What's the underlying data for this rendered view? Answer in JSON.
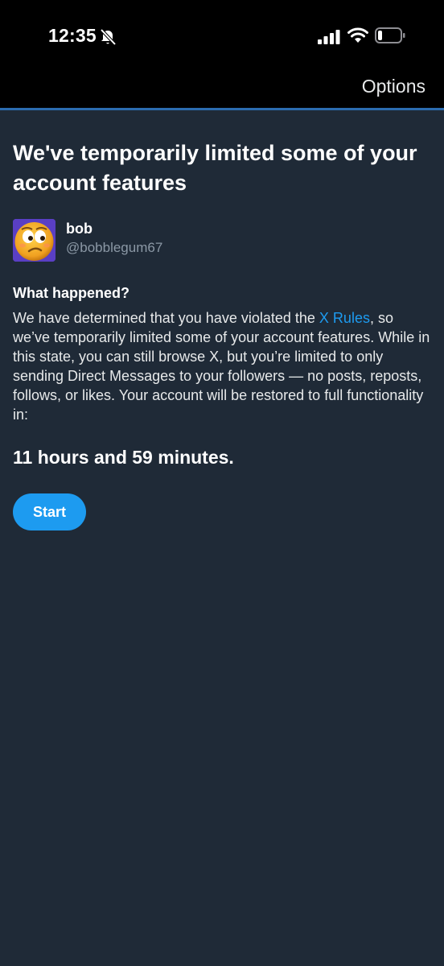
{
  "status_bar": {
    "time": "12:35",
    "icons": [
      "bell-muted-icon",
      "cellular-signal-icon",
      "wifi-icon",
      "battery-icon"
    ]
  },
  "navbar": {
    "options_label": "Options"
  },
  "notice": {
    "title": "We've temporarily limited some of your account features",
    "user": {
      "display_name": "bob",
      "handle": "@bobblegum67"
    },
    "section_heading": "What happened?",
    "body_before_link": "We have determined that you have violated the ",
    "link_text": "X Rules",
    "body_after_link": ", so we’ve temporarily limited some of your account features. While in this state, you can still browse X, but you’re limited to only sending Direct Messages to your followers — no posts, reposts, follows, or likes. Your account will be restored to full functionality in:",
    "countdown": "11 hours and 59 minutes.",
    "start_label": "Start"
  },
  "colors": {
    "background": "#1f2a37",
    "accent": "#1d9bf0",
    "header": "#000000",
    "divider": "#2b6cb0"
  }
}
